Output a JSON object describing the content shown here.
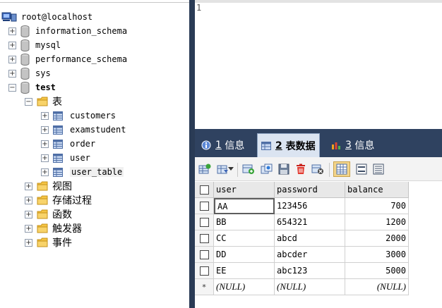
{
  "tree": {
    "connection": "root@localhost",
    "databases": [
      {
        "name": "information_schema",
        "expanded": false
      },
      {
        "name": "mysql",
        "expanded": false
      },
      {
        "name": "performance_schema",
        "expanded": false
      },
      {
        "name": "sys",
        "expanded": false
      },
      {
        "name": "test",
        "expanded": true
      }
    ],
    "tables_folder": "表",
    "tables": [
      "customers",
      "examstudent",
      "order",
      "user",
      "user_table"
    ],
    "other_folders": [
      "视图",
      "存储过程",
      "函数",
      "触发器",
      "事件"
    ]
  },
  "editor": {
    "line_number": "1"
  },
  "result_tabs": [
    {
      "num": "1",
      "label": "信息"
    },
    {
      "num": "2",
      "label": "表数据"
    },
    {
      "num": "3",
      "label": "信息"
    }
  ],
  "grid": {
    "columns": [
      "user",
      "password",
      "balance"
    ],
    "rows": [
      [
        "AA",
        "123456",
        "700"
      ],
      [
        "BB",
        "654321",
        "1200"
      ],
      [
        "CC",
        "abcd",
        "2000"
      ],
      [
        "DD",
        "abcder",
        "3000"
      ],
      [
        "EE",
        "abc123",
        "5000"
      ]
    ],
    "new_row_marker": "*",
    "null_text": "(NULL)"
  },
  "icons": {
    "connection": "server-icon",
    "database": "database-icon",
    "folder": "folder-icon",
    "table": "table-icon"
  },
  "colors": {
    "tab_bar": "#2f4260",
    "active_tab": "#dbe4f1",
    "splitter": "#2a3b55"
  }
}
